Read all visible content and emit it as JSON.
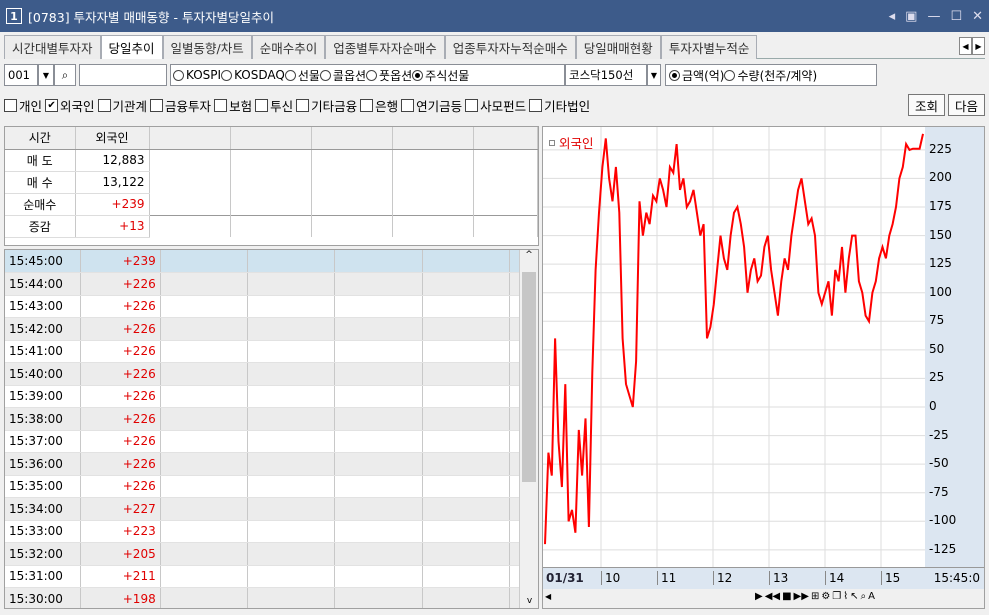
{
  "titlebar": {
    "num": "1",
    "title": "[0783] 투자자별 매매동향 - 투자자별당일추이"
  },
  "tabs": [
    "시간대별투자자",
    "당일추이",
    "일별동향/차트",
    "순매수추이",
    "업종별투자자순매수",
    "업종투자자누적순매수",
    "당일매매현황",
    "투자자별누적순"
  ],
  "controls": {
    "code": "001",
    "radios1": [
      "KOSPI",
      "KOSDAQ",
      "선물",
      "콜옵션",
      "풋옵션",
      "주식선물"
    ],
    "selected1": "주식선물",
    "market": "코스닥150선",
    "radios2": [
      "금액(억)",
      "수량(천주/계약)"
    ],
    "selected2": "금액(억)"
  },
  "investors": [
    {
      "label": "개인",
      "checked": false
    },
    {
      "label": "외국인",
      "checked": true
    },
    {
      "label": "기관계",
      "checked": false
    },
    {
      "label": "금융투자",
      "checked": false
    },
    {
      "label": "보험",
      "checked": false
    },
    {
      "label": "투신",
      "checked": false
    },
    {
      "label": "기타금융",
      "checked": false
    },
    {
      "label": "은행",
      "checked": false
    },
    {
      "label": "연기금등",
      "checked": false
    },
    {
      "label": "사모펀드",
      "checked": false
    },
    {
      "label": "기타법인",
      "checked": false
    }
  ],
  "buttons": {
    "query": "조회",
    "next": "다음"
  },
  "summary": {
    "h1": "시간",
    "h2": "외국인",
    "rows": [
      {
        "label": "매  도",
        "value": "12,883",
        "color": "#000"
      },
      {
        "label": "매  수",
        "value": "13,122",
        "color": "#000"
      },
      {
        "label": "순매수",
        "value": "+239",
        "color": "#e00000"
      },
      {
        "label": "증감",
        "value": "+13",
        "color": "#e00000"
      }
    ]
  },
  "rows": [
    [
      "15:45:00",
      "+239"
    ],
    [
      "15:44:00",
      "+226"
    ],
    [
      "15:43:00",
      "+226"
    ],
    [
      "15:42:00",
      "+226"
    ],
    [
      "15:41:00",
      "+226"
    ],
    [
      "15:40:00",
      "+226"
    ],
    [
      "15:39:00",
      "+226"
    ],
    [
      "15:38:00",
      "+226"
    ],
    [
      "15:37:00",
      "+226"
    ],
    [
      "15:36:00",
      "+226"
    ],
    [
      "15:35:00",
      "+226"
    ],
    [
      "15:34:00",
      "+227"
    ],
    [
      "15:33:00",
      "+223"
    ],
    [
      "15:32:00",
      "+205"
    ],
    [
      "15:31:00",
      "+211"
    ],
    [
      "15:30:00",
      "+198"
    ]
  ],
  "chart_data": {
    "type": "line",
    "legend": "외국인",
    "color": "#ff0000",
    "date": "01/31",
    "xticks": [
      "10",
      "11",
      "12",
      "13",
      "14",
      "15"
    ],
    "lastx": "15:45:0",
    "yticks": [
      225,
      200,
      175,
      150,
      125,
      100,
      75,
      50,
      25,
      0,
      -25,
      -50,
      -75,
      -100,
      -125
    ],
    "ylim": [
      -140,
      245
    ],
    "series": [
      {
        "name": "외국인",
        "values": [
          -120,
          -40,
          -60,
          60,
          -30,
          -70,
          20,
          -100,
          -90,
          -110,
          -20,
          -60,
          -10,
          -105,
          30,
          120,
          170,
          210,
          235,
          200,
          180,
          210,
          170,
          60,
          20,
          10,
          0,
          40,
          180,
          150,
          170,
          160,
          185,
          180,
          200,
          190,
          175,
          210,
          205,
          230,
          190,
          200,
          175,
          180,
          190,
          170,
          150,
          160,
          60,
          70,
          90,
          120,
          150,
          130,
          120,
          150,
          170,
          175,
          160,
          140,
          100,
          120,
          130,
          110,
          115,
          140,
          150,
          120,
          100,
          80,
          110,
          130,
          120,
          150,
          170,
          190,
          200,
          180,
          160,
          165,
          150,
          100,
          90,
          100,
          110,
          80,
          120,
          110,
          140,
          100,
          130,
          150,
          150,
          110,
          100,
          80,
          75,
          100,
          110,
          130,
          140,
          130,
          150,
          160,
          175,
          200,
          210,
          230,
          225,
          226,
          226,
          226,
          239
        ]
      }
    ]
  }
}
